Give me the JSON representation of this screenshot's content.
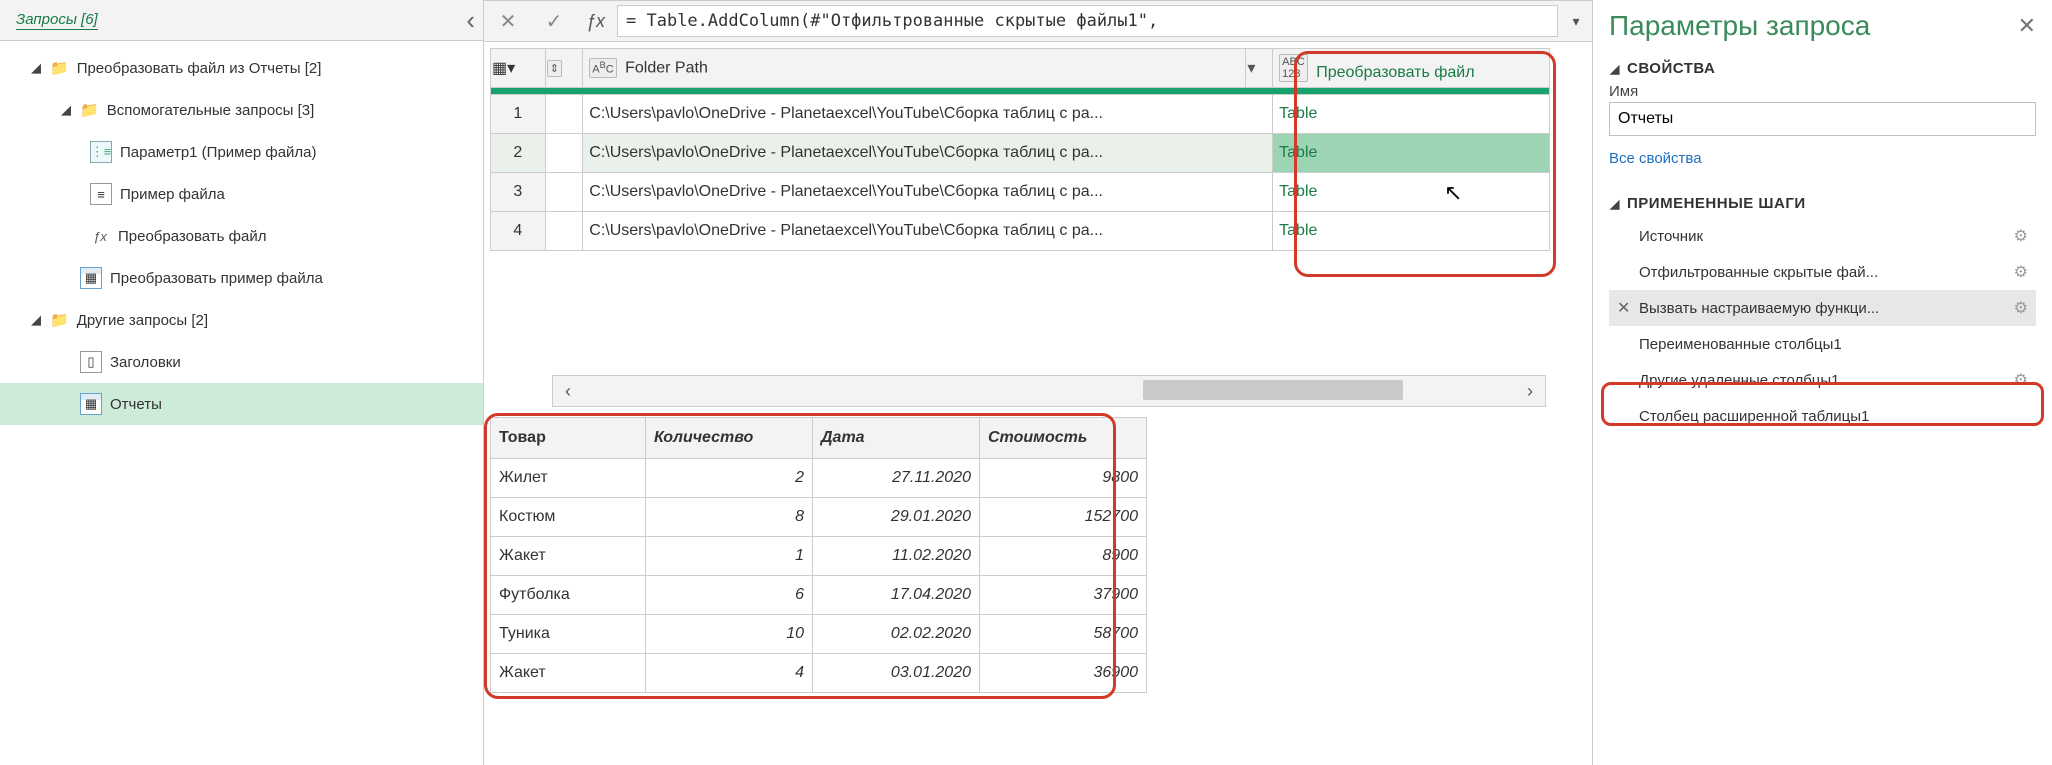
{
  "left": {
    "title": "Запросы [6]",
    "nodes": {
      "g1": "Преобразовать файл из Отчеты [2]",
      "g2": "Вспомогательные запросы [3]",
      "p1": "Параметр1 (Пример файла)",
      "p2": "Пример файла",
      "p3": "Преобразовать файл",
      "p4": "Преобразовать пример файла",
      "g3": "Другие запросы [2]",
      "p5": "Заголовки",
      "p6": "Отчеты"
    }
  },
  "formula": "= Table.AddColumn(#\"Отфильтрованные скрытые файлы1\",",
  "main_table": {
    "columns": {
      "folder": "Folder Path",
      "trans": "Преобразовать файл"
    },
    "rows": [
      {
        "n": "1",
        "fp": "C:\\Users\\pavlo\\OneDrive - Planetaexcel\\YouTube\\Сборка таблиц с ра...",
        "tr": "Table"
      },
      {
        "n": "2",
        "fp": "C:\\Users\\pavlo\\OneDrive - Planetaexcel\\YouTube\\Сборка таблиц с ра...",
        "tr": "Table"
      },
      {
        "n": "3",
        "fp": "C:\\Users\\pavlo\\OneDrive - Planetaexcel\\YouTube\\Сборка таблиц с ра...",
        "tr": "Table"
      },
      {
        "n": "4",
        "fp": "C:\\Users\\pavlo\\OneDrive - Planetaexcel\\YouTube\\Сборка таблиц с ра...",
        "tr": "Table"
      }
    ]
  },
  "preview": {
    "headers": {
      "a": "Товар",
      "b": "Количество",
      "c": "Дата",
      "d": "Стоимость"
    },
    "rows": [
      {
        "a": "Жилет",
        "b": "2",
        "c": "27.11.2020",
        "d": "9800"
      },
      {
        "a": "Костюм",
        "b": "8",
        "c": "29.01.2020",
        "d": "152700"
      },
      {
        "a": "Жакет",
        "b": "1",
        "c": "11.02.2020",
        "d": "8900"
      },
      {
        "a": "Футболка",
        "b": "6",
        "c": "17.04.2020",
        "d": "37900"
      },
      {
        "a": "Туника",
        "b": "10",
        "c": "02.02.2020",
        "d": "58700"
      },
      {
        "a": "Жакет",
        "b": "4",
        "c": "03.01.2020",
        "d": "36900"
      }
    ]
  },
  "right": {
    "title": "Параметры запроса",
    "props_h": "СВОЙСТВА",
    "name_label": "Имя",
    "name_value": "Отчеты",
    "all_props": "Все свойства",
    "steps_h": "ПРИМЕНЕННЫЕ ШАГИ",
    "steps": {
      "s1": "Источник",
      "s2": "Отфильтрованные скрытые фай...",
      "s3": "Вызвать настраиваемую функци...",
      "s4": "Переименованные столбцы1",
      "s5": "Другие удаленные столбцы1",
      "s6": "Столбец расширенной таблицы1"
    }
  }
}
